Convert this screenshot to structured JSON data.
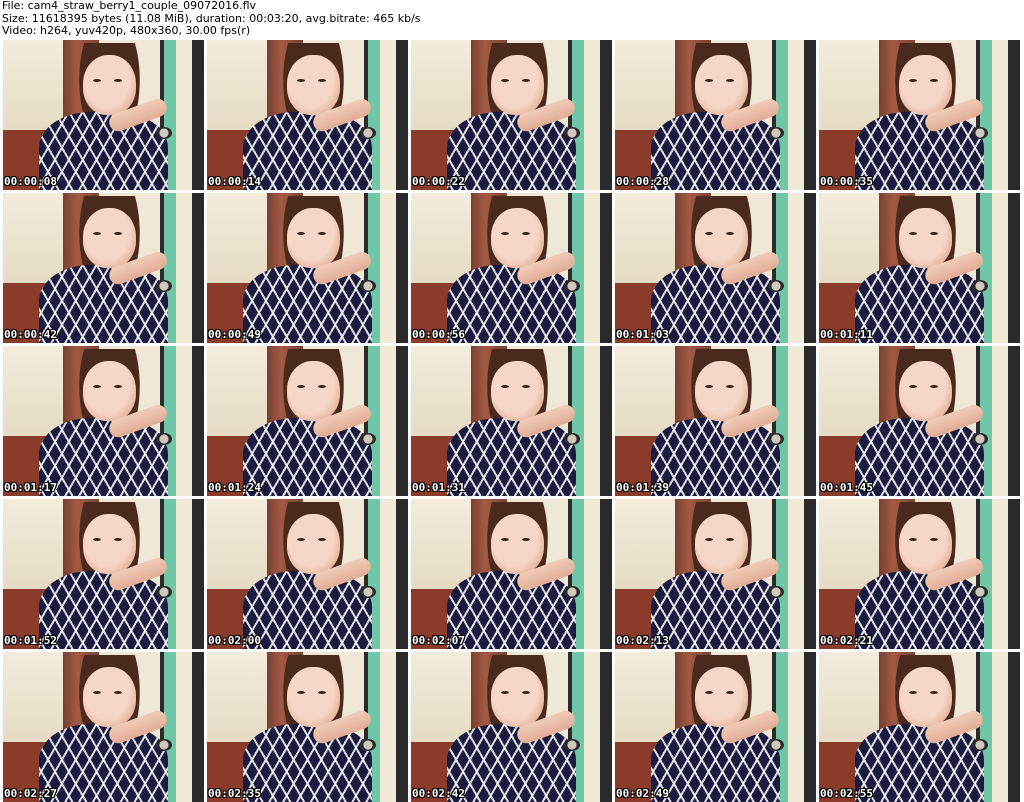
{
  "header": {
    "line1": "File: cam4_straw_berry1_couple_09072016.flv",
    "line2": "Size: 11618395 bytes (11.08 MiB), duration: 00:03:20, avg.bitrate: 465 kb/s",
    "line3": "Video: h264, yuv420p, 480x360, 30.00 fps(r)"
  },
  "thumbnails": [
    {
      "timestamp": "00:00:08"
    },
    {
      "timestamp": "00:00:14"
    },
    {
      "timestamp": "00:00:22"
    },
    {
      "timestamp": "00:00:28"
    },
    {
      "timestamp": "00:00:35"
    },
    {
      "timestamp": "00:00:42"
    },
    {
      "timestamp": "00:00:49"
    },
    {
      "timestamp": "00:00:56"
    },
    {
      "timestamp": "00:01:03"
    },
    {
      "timestamp": "00:01:11"
    },
    {
      "timestamp": "00:01:17"
    },
    {
      "timestamp": "00:01:24"
    },
    {
      "timestamp": "00:01:31"
    },
    {
      "timestamp": "00:01:39"
    },
    {
      "timestamp": "00:01:45"
    },
    {
      "timestamp": "00:01:52"
    },
    {
      "timestamp": "00:02:00"
    },
    {
      "timestamp": "00:02:07"
    },
    {
      "timestamp": "00:02:13"
    },
    {
      "timestamp": "00:02:21"
    },
    {
      "timestamp": "00:02:27"
    },
    {
      "timestamp": "00:02:35"
    },
    {
      "timestamp": "00:02:42"
    },
    {
      "timestamp": "00:02:49"
    },
    {
      "timestamp": "00:02:55"
    }
  ]
}
